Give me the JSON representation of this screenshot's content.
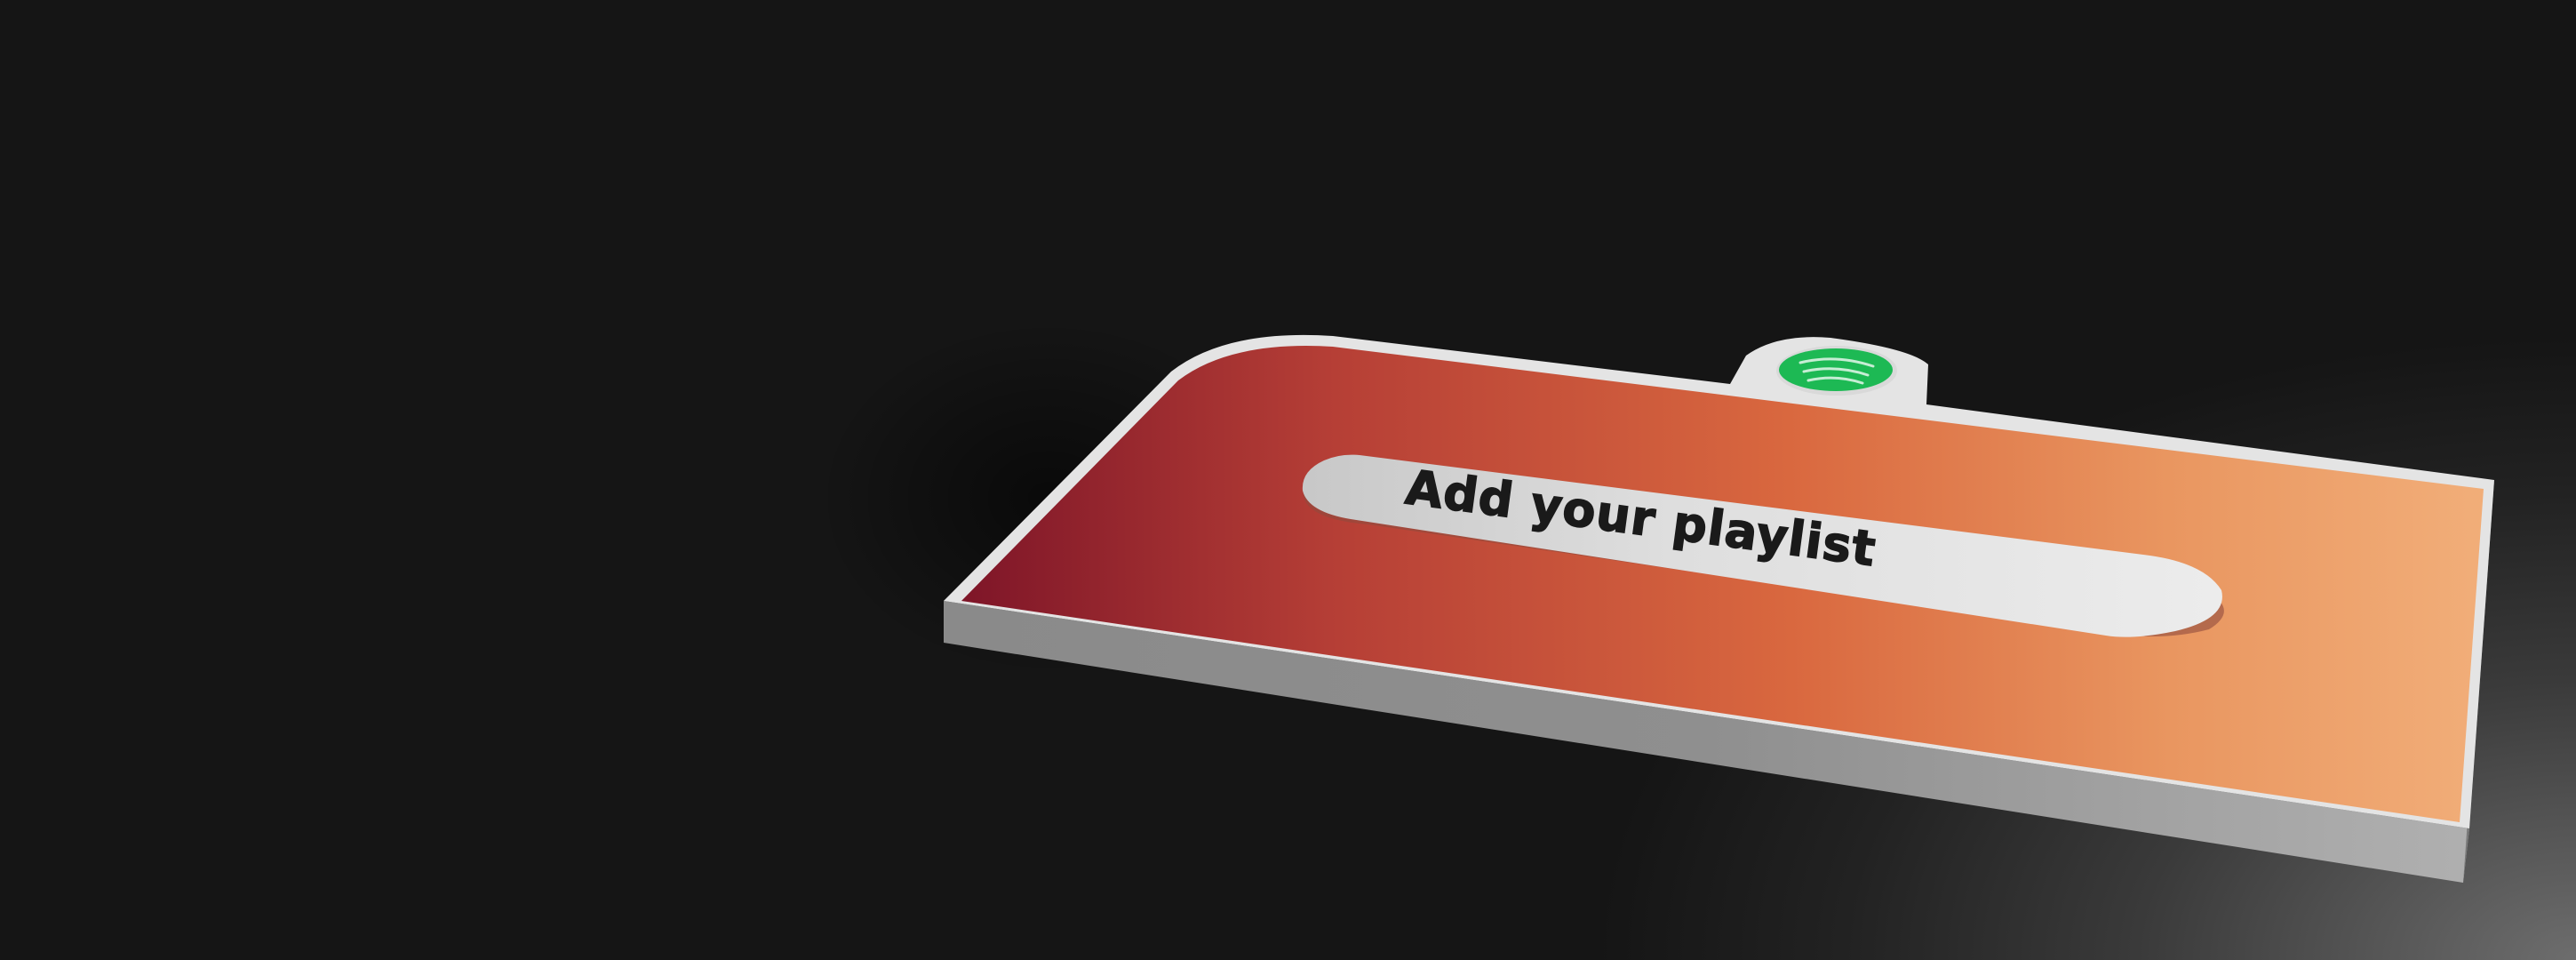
{
  "card": {
    "button_label": "Add your playlist"
  },
  "colors": {
    "background_dark": "#151515",
    "background_light": "#6d6d6d",
    "frame": "#e4e4e4",
    "frame_side": "#9a9a9a",
    "gradient_start": "#7e1528",
    "gradient_mid": "#d9683f",
    "gradient_end": "#f1ad78",
    "pill": "#e8e8e8",
    "pill_text": "#1a1a1a",
    "spotify_green": "#1db954"
  },
  "icons": {
    "badge": "spotify-logo-icon"
  }
}
